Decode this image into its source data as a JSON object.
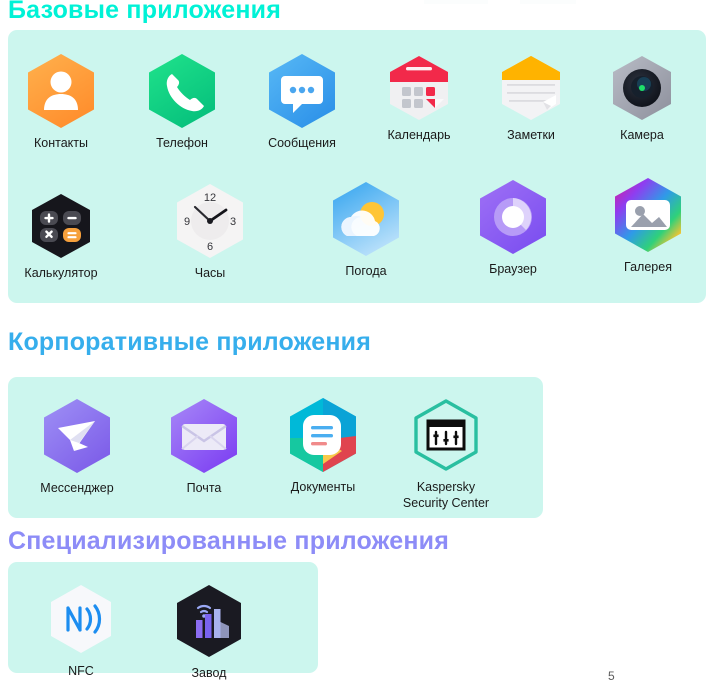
{
  "page": {
    "number": "5",
    "background": "#ffffff",
    "card_background": "#ccf6ee"
  },
  "sections": [
    {
      "id": "basic",
      "heading": "Базовые приложения",
      "heading_color": "#00f2d6",
      "apps": [
        {
          "label": "Контакты",
          "icon": "contacts-icon"
        },
        {
          "label": "Телефон",
          "icon": "phone-icon"
        },
        {
          "label": "Сообщения",
          "icon": "messages-icon"
        },
        {
          "label": "Календарь",
          "icon": "calendar-icon"
        },
        {
          "label": "Заметки",
          "icon": "notes-icon"
        },
        {
          "label": "Камера",
          "icon": "camera-icon"
        },
        {
          "label": "Калькулятор",
          "icon": "calculator-icon"
        },
        {
          "label": "Часы",
          "icon": "clock-icon"
        },
        {
          "label": "Погода",
          "icon": "weather-icon"
        },
        {
          "label": "Браузер",
          "icon": "browser-icon"
        },
        {
          "label": "Галерея",
          "icon": "gallery-icon"
        }
      ]
    },
    {
      "id": "corporate",
      "heading": "Корпоративные приложения",
      "heading_color": "#36aeec",
      "apps": [
        {
          "label": "Мессенджер",
          "icon": "messenger-icon"
        },
        {
          "label": "Почта",
          "icon": "mail-icon"
        },
        {
          "label": "Документы",
          "icon": "documents-icon"
        },
        {
          "label": "Kaspersky\nSecurity Center",
          "icon": "kaspersky-security-center-icon"
        }
      ]
    },
    {
      "id": "specialized",
      "heading": "Специализированные  приложения",
      "heading_color": "#8d8cf7",
      "apps": [
        {
          "label": "NFC",
          "icon": "nfc-icon"
        },
        {
          "label": "Завод",
          "icon": "factory-icon"
        }
      ]
    }
  ],
  "clock": {
    "tick_12": "12",
    "tick_3": "3",
    "tick_6": "6",
    "tick_9": "9"
  }
}
